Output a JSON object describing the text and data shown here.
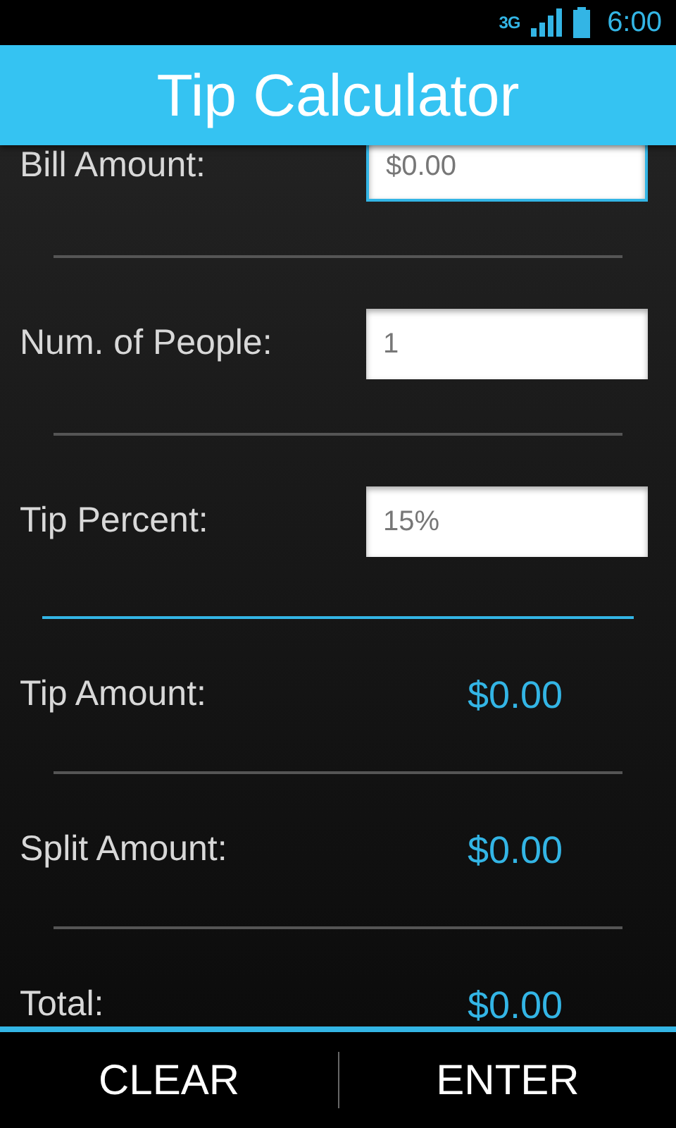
{
  "status_bar": {
    "network": "3G",
    "time": "6:00"
  },
  "title": "Tip Calculator",
  "inputs": [
    {
      "label": "Bill Amount:",
      "value": "$0.00",
      "focused": true
    },
    {
      "label": "Num. of People:",
      "value": "1",
      "focused": false
    },
    {
      "label": "Tip Percent:",
      "value": "15%",
      "focused": false
    }
  ],
  "results": [
    {
      "label": "Tip Amount:",
      "value": "$0.00"
    },
    {
      "label": "Split Amount:",
      "value": "$0.00"
    },
    {
      "label": "Total:",
      "value": "$0.00"
    }
  ],
  "buttons": [
    "CLEAR",
    "ENTER"
  ]
}
